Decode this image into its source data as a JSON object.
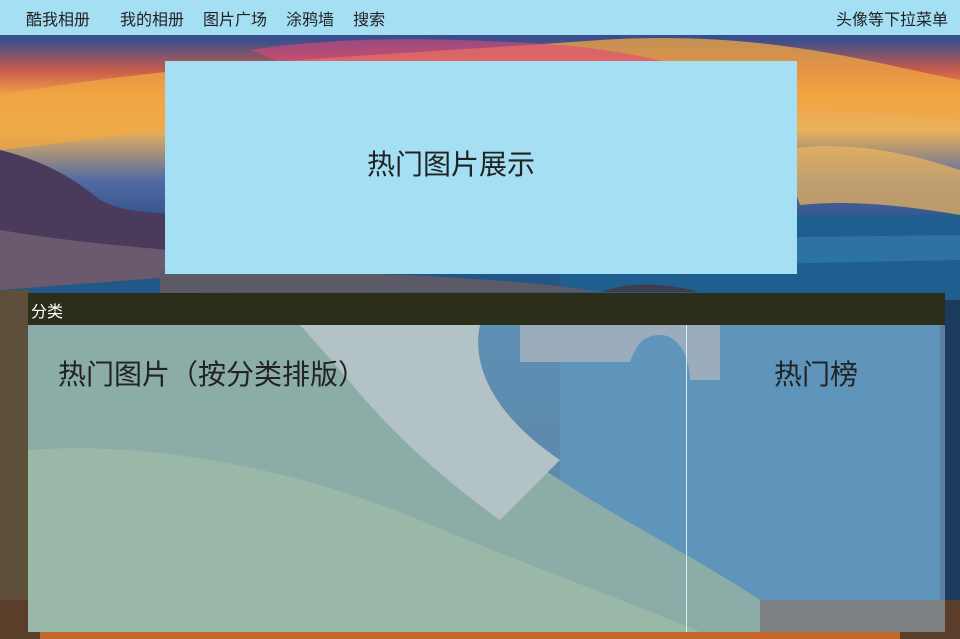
{
  "topbar": {
    "brand": "酷我相册",
    "nav": [
      "我的相册",
      "图片广场",
      "涂鸦墙",
      "搜索"
    ],
    "avatar_menu": "头像等下拉菜单"
  },
  "showcase": {
    "title": "热门图片展示"
  },
  "category": {
    "header": "分类",
    "hot_by_category": "热门图片（按分类排版）",
    "ranking": "热门榜"
  },
  "colors": {
    "accent": "#a5dff4",
    "header_dark": "#2c2e1a"
  }
}
